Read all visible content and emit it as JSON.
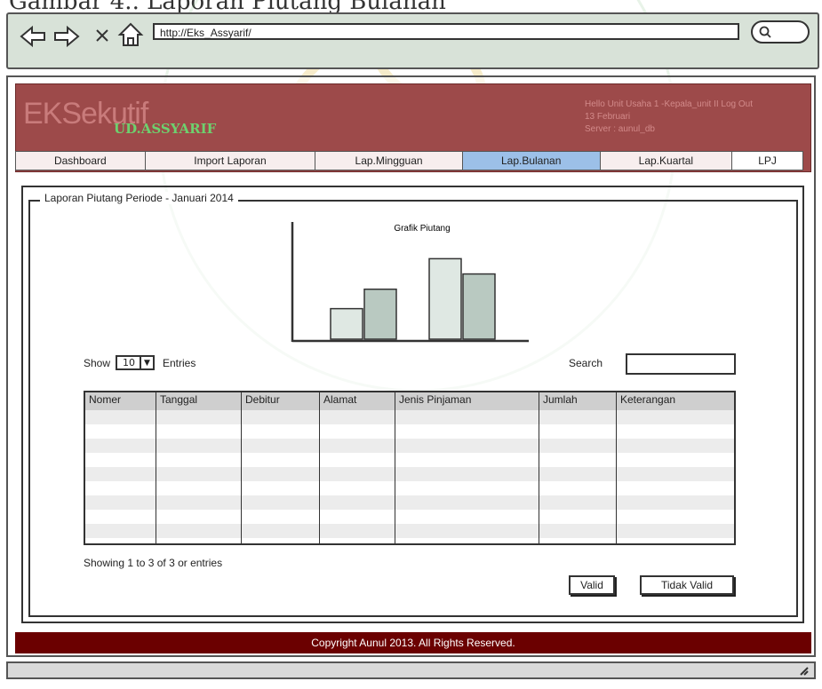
{
  "doc_caption": "Gambar 4.. Laporan Piutang Bulanan",
  "browser": {
    "url": "http://Eks_Assyarif/",
    "back_icon": "back-arrow-icon",
    "forward_icon": "forward-arrow-icon",
    "close_icon": "close-icon",
    "home_icon": "home-icon",
    "search_icon": "search-icon"
  },
  "header": {
    "brand": "EKSekutif",
    "brand_sub": "UD.ASSYARIF",
    "greeting": "Hello Unit Usaha 1 -Kepala_unit II Log Out",
    "date": "13 Februari",
    "server": "Server : aunul_db"
  },
  "tabs": [
    {
      "label": "Dashboard",
      "active": false
    },
    {
      "label": "Import Laporan",
      "active": false
    },
    {
      "label": "Lap.Mingguan",
      "active": false
    },
    {
      "label": "Lap.Bulanan",
      "active": true
    },
    {
      "label": "Lap.Kuartal",
      "active": false
    },
    {
      "label": "LPJ",
      "active": false
    }
  ],
  "report": {
    "legend": "Laporan Piutang Periode - Januari 2014",
    "show_label": "Show",
    "show_value": "10",
    "entries_label": "Entries",
    "search_label": "Search",
    "showing_text": "Showing 1 to 3 of 3 or entries",
    "valid_button": "Valid",
    "invalid_button": "Tidak Valid"
  },
  "chart_data": {
    "type": "bar",
    "title": "Grafik Piutang",
    "xlabel": "",
    "ylabel": "",
    "values": [
      22,
      36,
      58,
      47
    ],
    "ylim": [
      0,
      80
    ],
    "bar_colors": [
      "#dfe8e3",
      "#b9c9c1",
      "#dfe8e3",
      "#b9c9c1"
    ]
  },
  "table": {
    "columns": [
      "Nomer",
      "Tanggal",
      "Debitur",
      "Alamat",
      "Jenis Pinjaman",
      "Jumlah",
      "Keterangan"
    ],
    "rows": [
      [
        "",
        "",
        "",
        "",
        "",
        "",
        ""
      ],
      [
        "",
        "",
        "",
        "",
        "",
        "",
        ""
      ],
      [
        "",
        "",
        "",
        "",
        "",
        "",
        ""
      ]
    ]
  },
  "footer": {
    "copyright": "Copyright Aunul 2013. All Rights Reserved."
  },
  "colors": {
    "header_bg": "#9d4a4a",
    "active_tab": "#9cc0e8",
    "footer_bg": "#6b0000",
    "brand_sub": "#6ed06e"
  }
}
